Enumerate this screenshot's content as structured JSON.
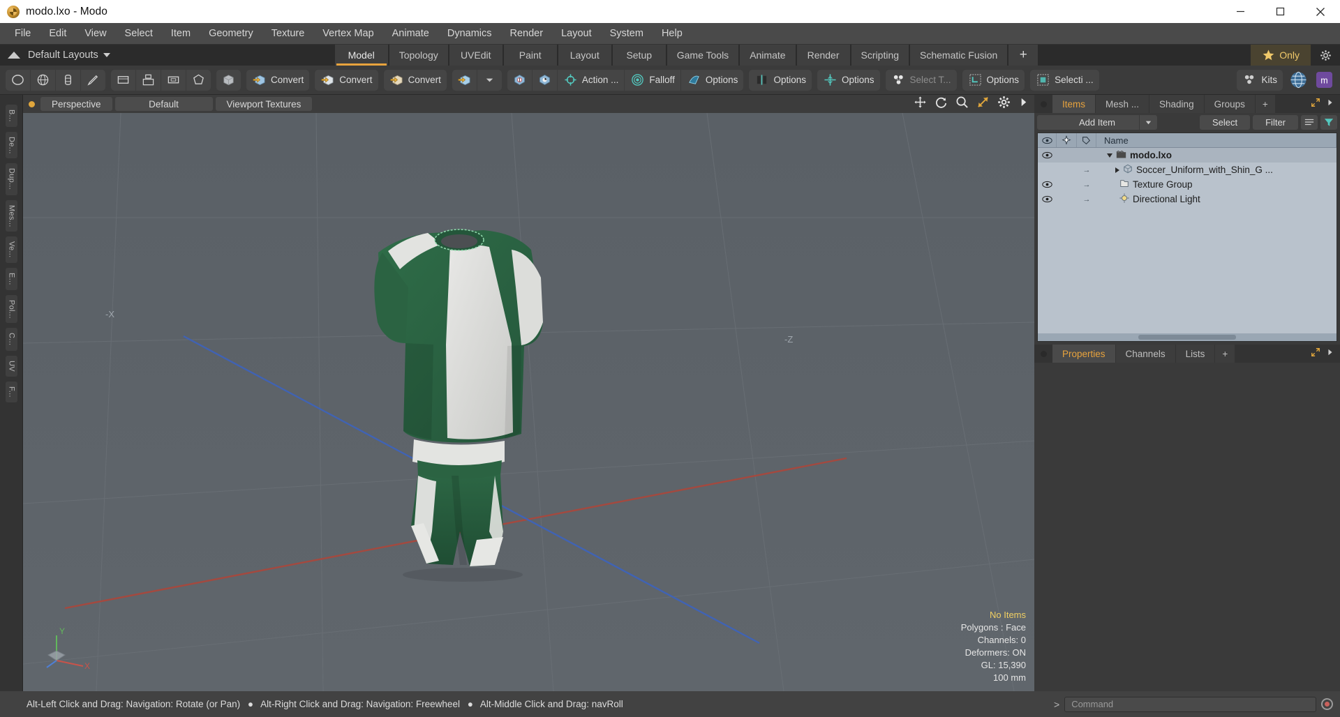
{
  "window": {
    "title": "modo.lxo - Modo",
    "app_icon": "modo-logo-icon",
    "minimize": "minimize-icon",
    "maximize": "maximize-icon",
    "close": "close-icon"
  },
  "menubar": {
    "items": [
      "File",
      "Edit",
      "View",
      "Select",
      "Item",
      "Geometry",
      "Texture",
      "Vertex Map",
      "Animate",
      "Dynamics",
      "Render",
      "Layout",
      "System",
      "Help"
    ]
  },
  "layoutbar": {
    "home_icon": "home-up-arrow-icon",
    "layout_label": "Default Layouts",
    "dropdown_icon": "chevron-down-icon",
    "tabs": [
      {
        "label": "Model",
        "active": true
      },
      {
        "label": "Topology",
        "active": false
      },
      {
        "label": "UVEdit",
        "active": false
      },
      {
        "label": "Paint",
        "active": false
      },
      {
        "label": "Layout",
        "active": false
      },
      {
        "label": "Setup",
        "active": false
      },
      {
        "label": "Game Tools",
        "active": false
      },
      {
        "label": "Animate",
        "active": false
      },
      {
        "label": "Render",
        "active": false
      },
      {
        "label": "Scripting",
        "active": false
      },
      {
        "label": "Schematic Fusion",
        "active": false
      }
    ],
    "add_tab": "+",
    "only_button": {
      "label": "Only",
      "star_icon": "star-icon"
    },
    "settings_icon": "gear-icon"
  },
  "toolbar": {
    "groups": [
      {
        "name": "primitives",
        "buttons": [
          {
            "label": "",
            "icon": "cylinder-primitive-icon"
          },
          {
            "label": "",
            "icon": "sphere-primitive-icon"
          },
          {
            "label": "",
            "icon": "capsule-primitive-icon"
          },
          {
            "label": "",
            "icon": "pen-tool-icon"
          }
        ]
      },
      {
        "name": "shape-tools",
        "buttons": [
          {
            "label": "",
            "icon": "rectangle-icon"
          },
          {
            "label": "",
            "icon": "cube-frame-icon"
          },
          {
            "label": "",
            "icon": "plane-icon"
          },
          {
            "label": "",
            "icon": "polygon-icon"
          }
        ]
      },
      {
        "name": "mesh-ops",
        "buttons": [
          {
            "label": "",
            "icon": "mesh-cube-icon"
          }
        ]
      },
      {
        "name": "convert-1",
        "buttons": [
          {
            "label": "Convert",
            "icon": "convert-cube-blue-icon"
          }
        ]
      },
      {
        "name": "convert-2",
        "buttons": [
          {
            "label": "Convert",
            "icon": "convert-cube-white-icon"
          }
        ]
      },
      {
        "name": "convert-3",
        "buttons": [
          {
            "label": "Convert",
            "icon": "convert-cube-tan-icon"
          }
        ]
      },
      {
        "name": "convert-dropdown",
        "buttons": [
          {
            "label": "",
            "icon": "convert-cube-icon"
          },
          {
            "label": "",
            "icon": "chevron-down-icon"
          }
        ]
      },
      {
        "name": "action-center",
        "buttons": [
          {
            "label": "",
            "icon": "action-center-cube-icon"
          },
          {
            "label": "",
            "icon": "action-axis-cube-icon"
          },
          {
            "label": "Action  ...",
            "icon": "action-target-icon"
          },
          {
            "label": "Falloff",
            "icon": "falloff-radial-icon"
          },
          {
            "label": "Options",
            "icon": "snapping-icon"
          }
        ]
      },
      {
        "name": "options-symmetry",
        "buttons": [
          {
            "label": "Options",
            "icon": "symmetry-icon"
          }
        ]
      },
      {
        "name": "options-workplane",
        "buttons": [
          {
            "label": "Options",
            "icon": "workplane-icon"
          }
        ]
      },
      {
        "name": "select-through",
        "buttons": [
          {
            "label": "Select T...",
            "icon": "select-through-icon",
            "dim": true
          }
        ]
      },
      {
        "name": "options-selection-set",
        "buttons": [
          {
            "label": "Options",
            "icon": "selection-region-icon"
          }
        ]
      },
      {
        "name": "selection",
        "buttons": [
          {
            "label": "Selecti ...",
            "icon": "selection-mode-icon"
          }
        ]
      },
      {
        "name": "kits",
        "buttons": [
          {
            "label": "Kits",
            "icon": "kits-icon"
          }
        ]
      }
    ],
    "right_icons": [
      "globe-icon",
      "modo-badge-icon"
    ]
  },
  "leftstrip": {
    "tabs": [
      "B...",
      "De...",
      "Dup...",
      "Mes...",
      "Ve...",
      "E...",
      "Pol...",
      "C...",
      "UV",
      "F..."
    ]
  },
  "viewport": {
    "dot_icon": "viewport-active-dot",
    "tabs": [
      {
        "label": "Perspective"
      },
      {
        "label": "Default"
      },
      {
        "label": "Viewport Textures"
      }
    ],
    "tools": [
      "pan-icon",
      "rotate-icon",
      "zoom-icon",
      "fit-icon",
      "gear-icon",
      "play-arrow-icon"
    ],
    "axis_labels": {
      "x_neg": "-X",
      "z_neg": "-Z",
      "gizmo_y": "Y",
      "gizmo_x": "X"
    },
    "stats": [
      {
        "label": "No Items",
        "value": ""
      },
      {
        "label": "Polygons :",
        "value": "Face"
      },
      {
        "label": "Channels:",
        "value": "0"
      },
      {
        "label": "Deformers:",
        "value": "ON"
      },
      {
        "label": "GL:",
        "value": "15,390"
      },
      {
        "label": "",
        "value": "100 mm"
      }
    ]
  },
  "rightpanel": {
    "tabs": [
      {
        "label": "Items",
        "active": true
      },
      {
        "label": "Mesh ...",
        "active": false
      },
      {
        "label": "Shading",
        "active": false
      },
      {
        "label": "Groups",
        "active": false
      },
      {
        "label": "+",
        "active": false
      }
    ],
    "tab_icons": [
      "expand-icon",
      "menu-arrow-icon"
    ],
    "add_item": {
      "label": "Add Item",
      "dropdown_icon": "chevron-down-icon"
    },
    "select_button": "Select",
    "filter_button": "Filter",
    "filter_icons": [
      "list-icon",
      "funnel-icon"
    ],
    "tree": {
      "columns": [
        "eye-icon",
        "pin-icon",
        "tag-icon",
        "Name"
      ],
      "rows": [
        {
          "name": "modo.lxo",
          "visible": true,
          "bold": true,
          "depth": 0,
          "expander": "down",
          "icon": "scene-icon"
        },
        {
          "name": "Soccer_Uniform_with_Shin_G ...",
          "visible": false,
          "bold": false,
          "depth": 1,
          "expander": "right",
          "icon": "mesh-item-icon"
        },
        {
          "name": "Texture Group",
          "visible": true,
          "bold": false,
          "depth": 1,
          "expander": "none",
          "icon": "texture-group-icon"
        },
        {
          "name": "Directional Light",
          "visible": true,
          "bold": false,
          "depth": 1,
          "expander": "none",
          "icon": "light-icon"
        }
      ]
    },
    "lower_tabs": [
      {
        "label": "Properties",
        "active": true
      },
      {
        "label": "Channels",
        "active": false
      },
      {
        "label": "Lists",
        "active": false
      },
      {
        "label": "+",
        "active": false
      }
    ]
  },
  "statusbar": {
    "hints": [
      "Alt-Left Click and Drag: Navigation: Rotate (or Pan)",
      "Alt-Right Click and Drag: Navigation: Freewheel",
      "Alt-Middle Click and Drag: navRoll"
    ],
    "separator": "●",
    "command_prompt": ">",
    "command_placeholder": "Command",
    "record_icon": "record-icon"
  },
  "colors": {
    "accent_orange": "#e8a33d",
    "panel_bg": "#3a3a3a",
    "viewport_bg": "#5e646a",
    "tree_bg": "#b9c2cc",
    "status_yellow": "#f0cf63",
    "model_green": "#2e6b46"
  }
}
